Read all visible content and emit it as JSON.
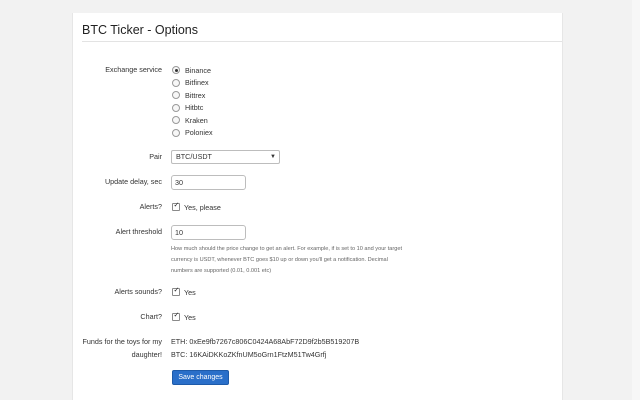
{
  "page": {
    "title": "BTC Ticker - Options"
  },
  "exchange": {
    "label": "Exchange service",
    "options": [
      "Binance",
      "Bitfinex",
      "Bittrex",
      "Hitbtc",
      "Kraken",
      "Poloniex"
    ],
    "selected": "Binance"
  },
  "pair": {
    "label": "Pair",
    "value": "BTC/USDT"
  },
  "update_delay": {
    "label": "Update delay, sec",
    "value": "30"
  },
  "alerts": {
    "label": "Alerts?",
    "checkbox_label": "Yes, please",
    "checked": true
  },
  "alert_threshold": {
    "label": "Alert threshold",
    "value": "10",
    "help": [
      "How much should the price change to get an alert. For example, if is set to 10 and your target",
      "currency is USDT, whenever BTC goes $10 up or down you'll get a notification. Decimal",
      "numbers are supported (0.01, 0.001 etc)"
    ]
  },
  "alerts_sounds": {
    "label": "Alerts sounds?",
    "checkbox_label": "Yes",
    "checked": true
  },
  "chart": {
    "label": "Chart?",
    "checkbox_label": "Yes",
    "checked": true
  },
  "funds": {
    "label_line1": "Funds for the toys for my",
    "label_line2": "daughter!",
    "eth": "ETH: 0xEe9fb7267c806C0424A68AbF72D9f2b5B519207B",
    "btc": "BTC: 16KAiDKKoZKfnUM5oGrn1FtzM51Tw4Grfj"
  },
  "save_button": {
    "label": "Save changes"
  },
  "colors": {
    "button": "#2a6fc9",
    "page_bg": "#f2f2f2",
    "panel_bg": "#ffffff"
  }
}
